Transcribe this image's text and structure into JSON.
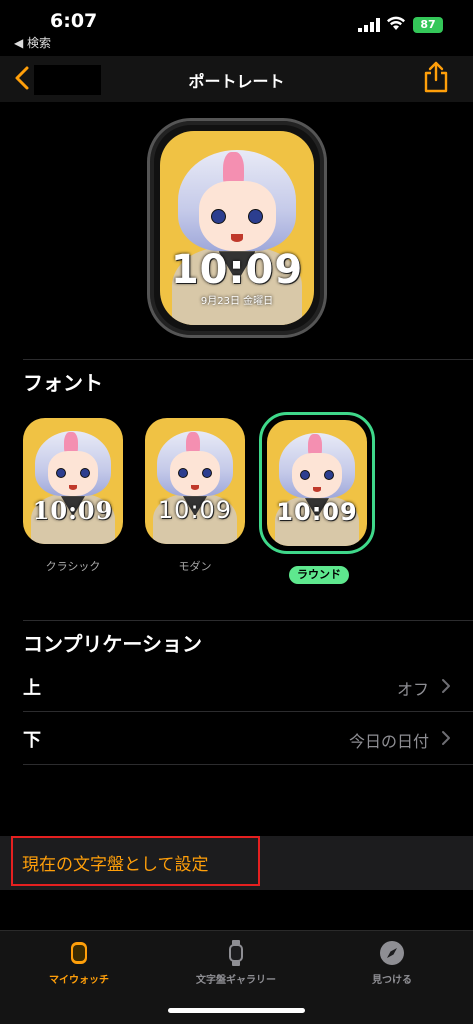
{
  "status": {
    "time": "6:07",
    "back_app": "◀ 検索",
    "battery": "87"
  },
  "nav": {
    "title": "ポートレート"
  },
  "preview": {
    "time": "10:09",
    "date": "9月23日 金曜日"
  },
  "font_section": {
    "title": "フォント",
    "options": [
      {
        "label": "クラシック",
        "time": "10:09"
      },
      {
        "label": "モダン",
        "time": "10:09"
      },
      {
        "label": "ラウンド",
        "time": "10:09",
        "selected": true
      }
    ]
  },
  "complication_section": {
    "title": "コンプリケーション",
    "rows": [
      {
        "key": "上",
        "value": "オフ"
      },
      {
        "key": "下",
        "value": "今日の日付"
      }
    ]
  },
  "action": {
    "label": "現在の文字盤として設定"
  },
  "tabbar": {
    "tabs": [
      {
        "label": "マイウォッチ",
        "icon": "watch-face-icon",
        "active": true
      },
      {
        "label": "文字盤ギャラリー",
        "icon": "watch-icon"
      },
      {
        "label": "見つける",
        "icon": "compass-icon"
      }
    ]
  },
  "colors": {
    "accent": "#ff9f0a",
    "selected_ring": "#3fd88a",
    "highlight_box": "#e52020"
  }
}
